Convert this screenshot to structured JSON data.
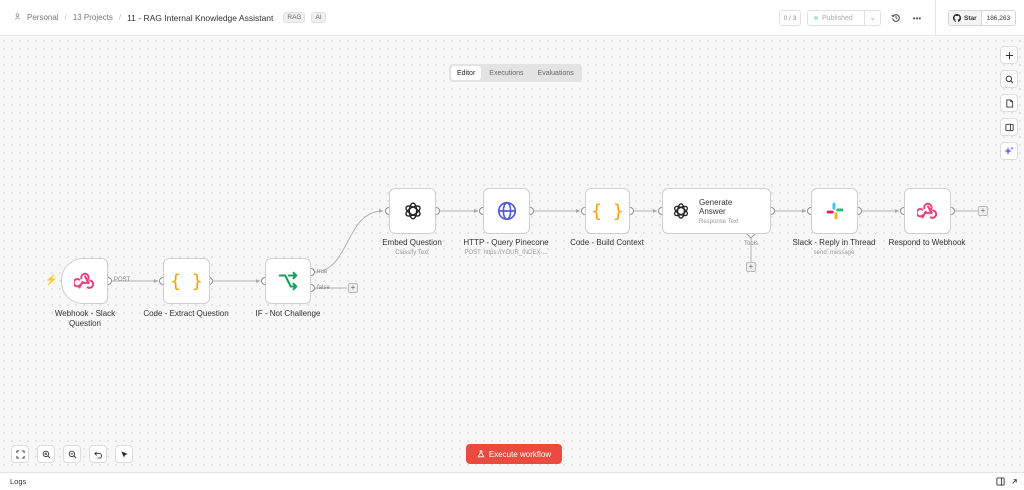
{
  "header": {
    "breadcrumb_personal": "Personal",
    "breadcrumb_projects": "13 Projects",
    "workflow_title": "11 - RAG Internal Knowledge Assistant",
    "tags": [
      "RAG",
      "AI"
    ],
    "counter": "0 / 3",
    "published_label": "Published",
    "github_star": "Star",
    "github_count": "186,263"
  },
  "modes": [
    "Editor",
    "Executions",
    "Evaluations"
  ],
  "active_mode": "Editor",
  "nodes": {
    "webhook": {
      "label": "Webhook - Slack Question"
    },
    "code_extract": {
      "label": "Code - Extract Question"
    },
    "if": {
      "label": "IF - Not Challenge",
      "true_label": "true",
      "false_label": "false"
    },
    "embed": {
      "label": "Embed Question",
      "sub": "Classify Text"
    },
    "http": {
      "label": "HTTP - Query Pinecone",
      "sub": "POST: https://YOUR_INDEX-..."
    },
    "code_build": {
      "label": "Code - Build Context"
    },
    "generate": {
      "title": "Generate Answer",
      "sub": "Response Text",
      "tools_label": "Tools"
    },
    "slack": {
      "label": "Slack - Reply in Thread",
      "sub": "send: message"
    },
    "respond": {
      "label": "Respond to Webhook"
    }
  },
  "edge_labels": {
    "post": "POST"
  },
  "execute_button": "Execute workflow",
  "logs_label": "Logs",
  "colors": {
    "accent": "#ea4b3e",
    "webhook": "#e8427d",
    "code": "#f59e0b",
    "if": "#1a9e5b",
    "http": "#4f5bd5"
  }
}
